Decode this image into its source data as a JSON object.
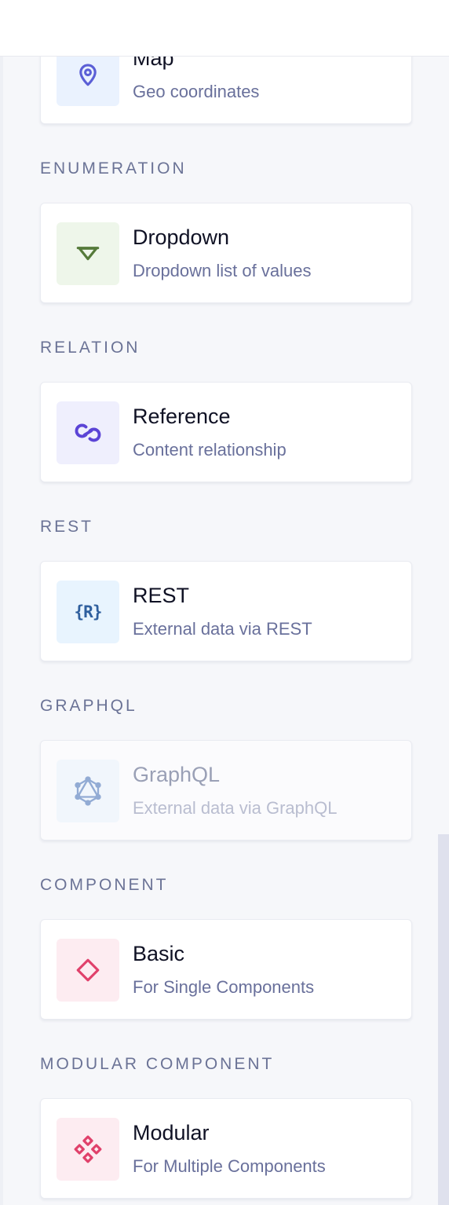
{
  "cards": {
    "map": {
      "title": "Map",
      "description": "Geo coordinates",
      "icon": "map-pin-icon",
      "icon_bg": "#eaf2fe",
      "icon_color": "#5b5fd6"
    },
    "dropdown": {
      "title": "Dropdown",
      "description": "Dropdown list of values",
      "icon": "triangle-down-icon",
      "icon_bg": "#eef6ea",
      "icon_color": "#557a3a"
    },
    "reference": {
      "title": "Reference",
      "description": "Content relationship",
      "icon": "link-icon",
      "icon_bg": "#efeffd",
      "icon_color": "#5b44d6"
    },
    "rest": {
      "title": "REST",
      "description": "External data via REST",
      "icon": "rest-braces-icon",
      "icon_bg": "#e8f4fe",
      "icon_color": "#2f5f9e"
    },
    "graphql": {
      "title": "GraphQL",
      "description": "External data via GraphQL",
      "icon": "graphql-icon",
      "icon_bg": "#eaf2fc",
      "icon_color": "#5b86c6",
      "disabled": true
    },
    "basic": {
      "title": "Basic",
      "description": "For Single Components",
      "icon": "diamond-icon",
      "icon_bg": "#fdecf1",
      "icon_color": "#e0416b"
    },
    "modular": {
      "title": "Modular",
      "description": "For Multiple Components",
      "icon": "diamond-cluster-icon",
      "icon_bg": "#fdecf1",
      "icon_color": "#e0416b"
    }
  },
  "sections": {
    "enumeration": "ENUMERATION",
    "relation": "RELATION",
    "rest": "REST",
    "graphql": "GRAPHQL",
    "component": "COMPONENT",
    "modular_component": "MODULAR COMPONENT"
  },
  "rest_icon_glyph": "{R}"
}
